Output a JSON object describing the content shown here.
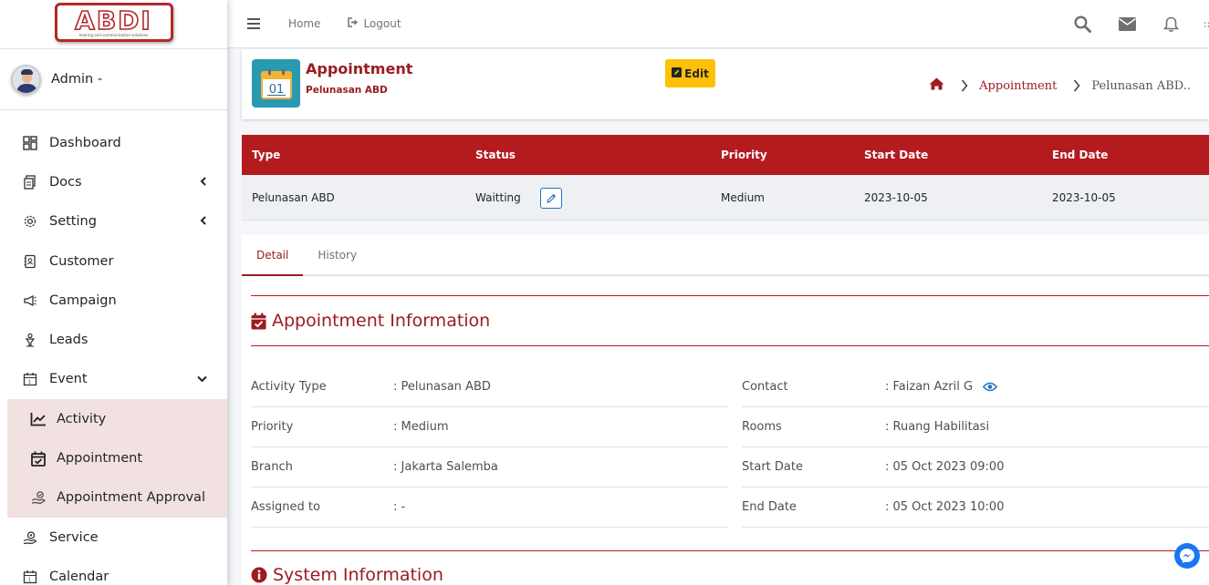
{
  "brand": {
    "logo_text": "ABDI",
    "logo_tagline": "hearing and communication solutions"
  },
  "user": {
    "name": "Admin -"
  },
  "sidebar": {
    "items": [
      {
        "label": "Dashboard",
        "icon": "dashboard-icon"
      },
      {
        "label": "Docs",
        "icon": "docs-icon",
        "expandable": true
      },
      {
        "label": "Setting",
        "icon": "gear-icon",
        "expandable": true
      },
      {
        "label": "Customer",
        "icon": "address-book-icon"
      },
      {
        "label": "Campaign",
        "icon": "megaphone-icon"
      },
      {
        "label": "Leads",
        "icon": "leads-icon"
      },
      {
        "label": "Event",
        "icon": "calendar-icon",
        "expanded": true
      }
    ],
    "event_children": [
      {
        "label": "Activity",
        "icon": "chart-line-icon"
      },
      {
        "label": "Appointment",
        "icon": "calendar-check-icon"
      },
      {
        "label": "Appointment Approval",
        "icon": "hand-approve-icon"
      }
    ],
    "items_after": [
      {
        "label": "Service",
        "icon": "service-icon"
      },
      {
        "label": "Calendar",
        "icon": "calendar-icon"
      }
    ]
  },
  "topbar": {
    "home_label": "Home",
    "logout_label": "Logout",
    "icons": [
      "search-icon",
      "envelope-icon",
      "bell-icon",
      "expand-icon"
    ]
  },
  "header": {
    "title": "Appointment",
    "subtitle": "Pelunasan ABD",
    "calendar_day": "01",
    "edit_label": "Edit",
    "breadcrumb": {
      "link": "Appointment",
      "current": "Pelunasan  ABD.."
    }
  },
  "summary": {
    "columns": [
      "Type",
      "Status",
      "Priority",
      "Start Date",
      "End Date"
    ],
    "row": {
      "type": "Pelunasan ABD",
      "status": "Waitting",
      "priority": "Medium",
      "start_date": "2023-10-05",
      "end_date": "2023-10-05"
    }
  },
  "tabs": [
    {
      "label": "Detail",
      "active": true
    },
    {
      "label": "History",
      "active": false
    }
  ],
  "appointment_info": {
    "heading": "Appointment Information",
    "left": [
      {
        "label": "Activity Type",
        "value": ": Pelunasan ABD"
      },
      {
        "label": "Priority",
        "value": ": Medium"
      },
      {
        "label": "Branch",
        "value": ": Jakarta Salemba"
      },
      {
        "label": "Assigned to",
        "value": ": -"
      }
    ],
    "right": [
      {
        "label": "Contact",
        "value": ": Faizan Azril G"
      },
      {
        "label": "Rooms",
        "value": ": Ruang Habilitasi"
      },
      {
        "label": "Start Date",
        "value": ": 05 Oct 2023 09:00"
      },
      {
        "label": "End Date",
        "value": ": 05 Oct 2023 10:00"
      }
    ]
  },
  "system_info": {
    "heading": "System Information"
  },
  "colors": {
    "accent": "#9b1c20",
    "header_red": "#b31b1f",
    "edit_yellow": "#ffc107",
    "submenu_bg": "#f2e1e1",
    "calendar_teal": "#2a9ab0"
  }
}
